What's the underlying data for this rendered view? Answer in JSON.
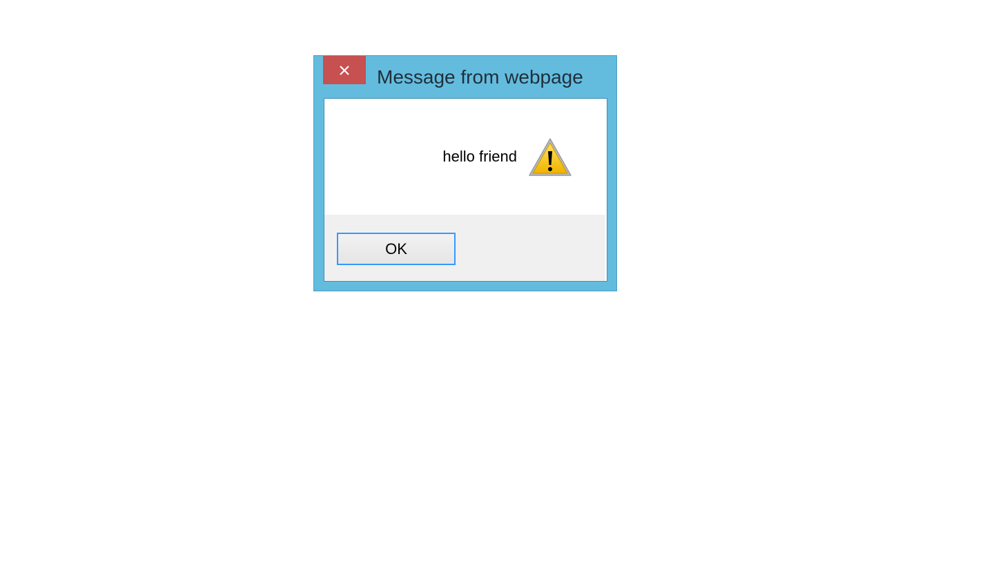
{
  "dialog": {
    "title": "Message from webpage",
    "close_icon": "close-icon",
    "message": "hello friend",
    "message_icon": "warning-icon",
    "ok_label": "OK"
  },
  "colors": {
    "frame": "#63bcde",
    "close_button": "#c75050",
    "button_focus_border": "#3399ff",
    "footer": "#f0f0f0",
    "warning_fill": "#f5c400"
  }
}
